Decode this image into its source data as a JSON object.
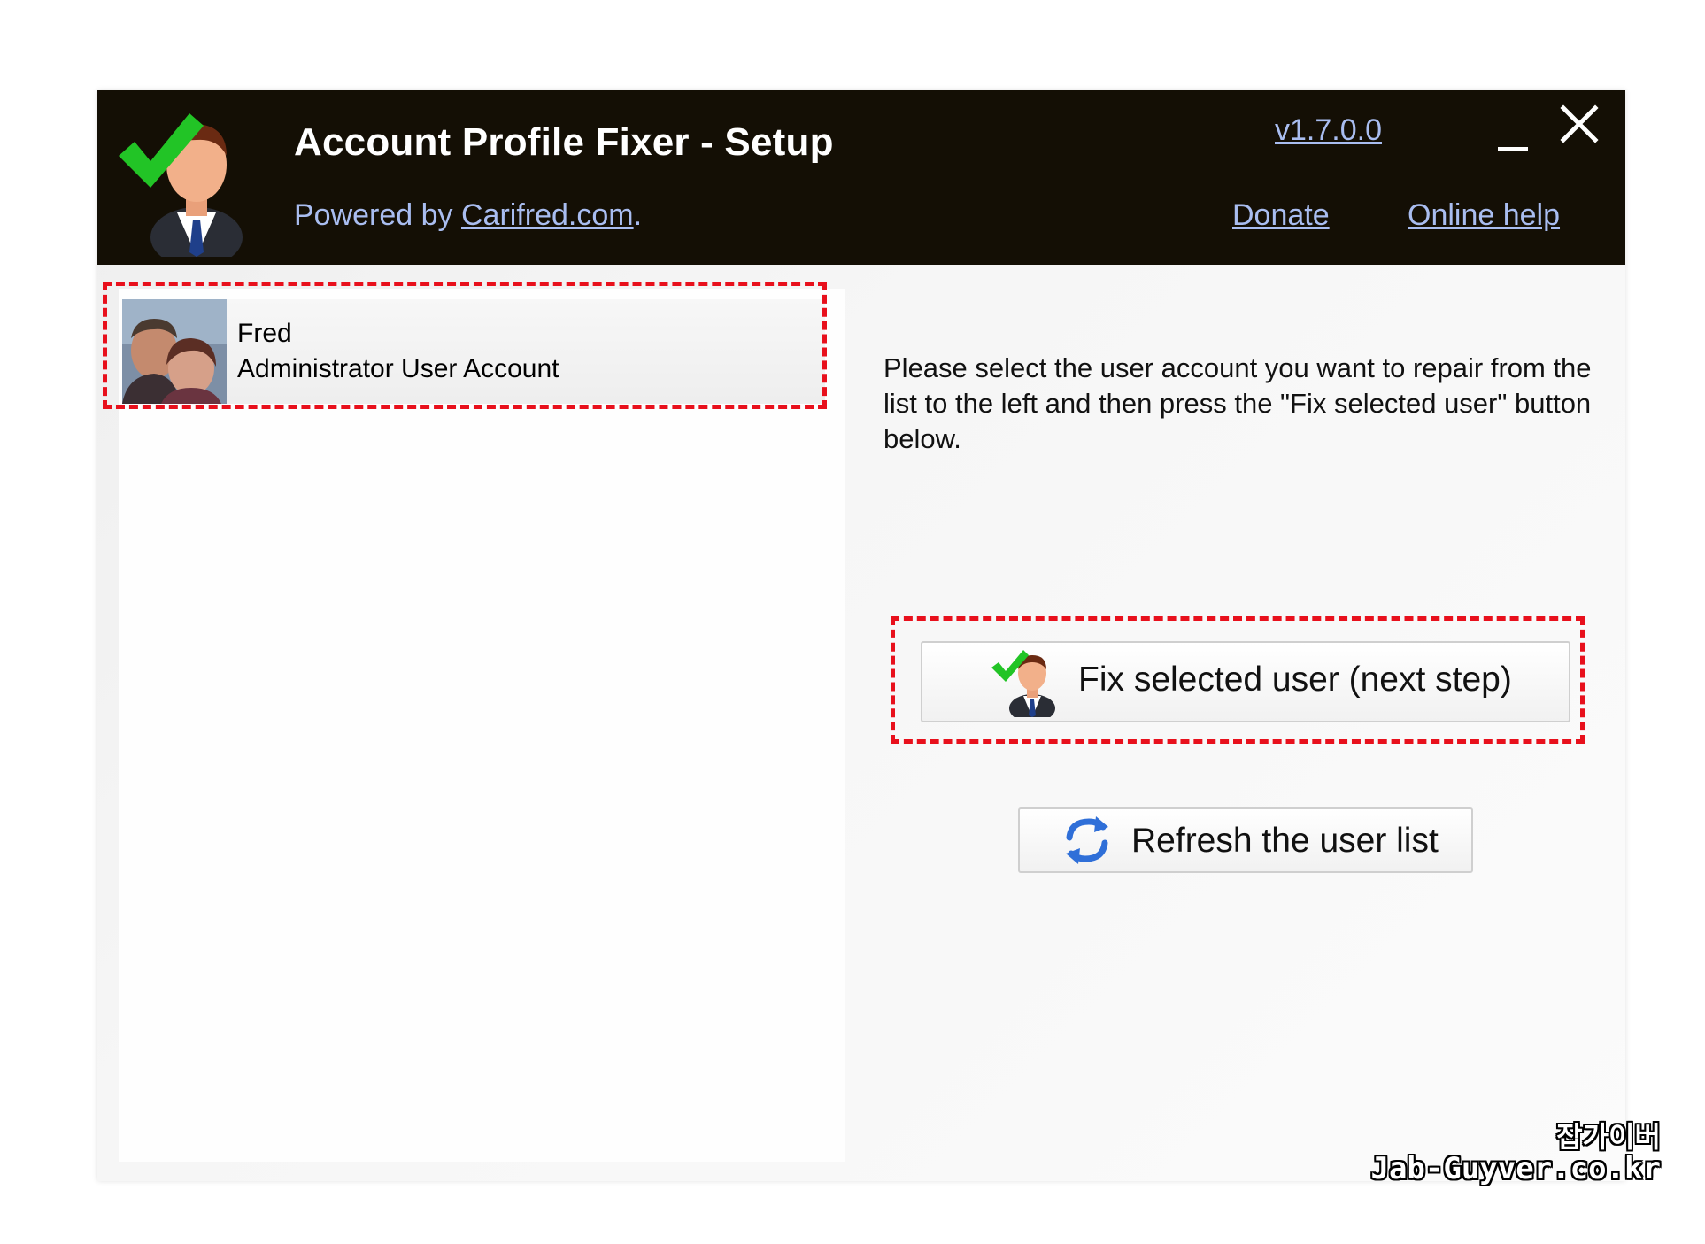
{
  "header": {
    "title": "Account Profile Fixer - Setup",
    "powered_by_prefix": "Powered by ",
    "powered_by_link": "Carifred.com",
    "powered_by_suffix": ".",
    "version": "v1.7.0.0",
    "donate": "Donate",
    "online_help": "Online help"
  },
  "user_list": {
    "items": [
      {
        "name": "Fred",
        "type": "Administrator User Account"
      }
    ]
  },
  "main": {
    "instructions": "Please select the user account you want to repair from the list to the left and then press the \"Fix selected user\" button below.",
    "fix_button": "Fix selected user (next step)",
    "refresh_button": "Refresh the user list"
  },
  "watermark": {
    "line1": "잡가이버",
    "line2": "Jab-Guyver.co.kr"
  },
  "colors": {
    "header_bg": "#140f05",
    "link": "#a9bdf0",
    "highlight": "#e8101c"
  },
  "icons": {
    "app_logo": "user-checkmark-icon",
    "fix_button_icon": "user-checkmark-icon",
    "refresh_button_icon": "refresh-arrows-icon"
  }
}
